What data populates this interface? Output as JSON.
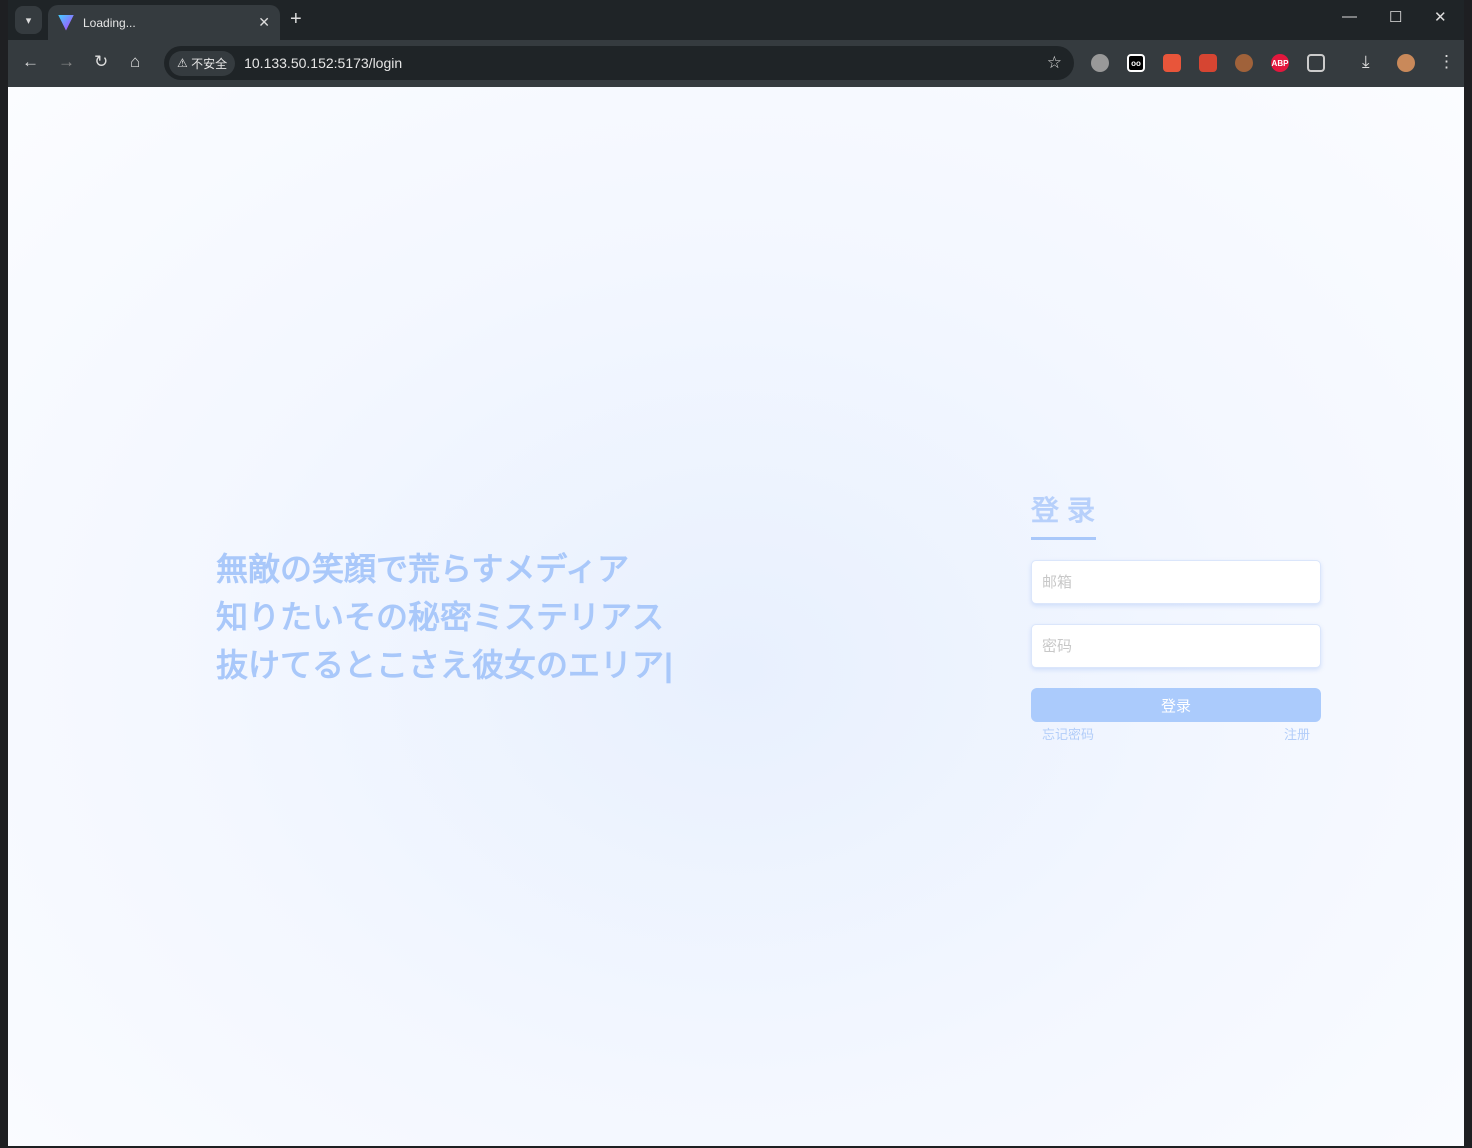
{
  "browser": {
    "tab_title": "Loading...",
    "new_tab": "+",
    "close_tab": "✕",
    "insecure_label": "不安全",
    "url": "10.133.50.152:5173/login"
  },
  "lyrics": [
    "無敵の笑顔で荒らすメディア",
    "知りたいその秘密ミステリアス",
    "抜けてるとこさえ彼女のエリア|"
  ],
  "login": {
    "title": "登录",
    "email_placeholder": "邮箱",
    "password_placeholder": "密码",
    "submit": "登录",
    "forgot": "忘记密码",
    "register": "注册"
  }
}
